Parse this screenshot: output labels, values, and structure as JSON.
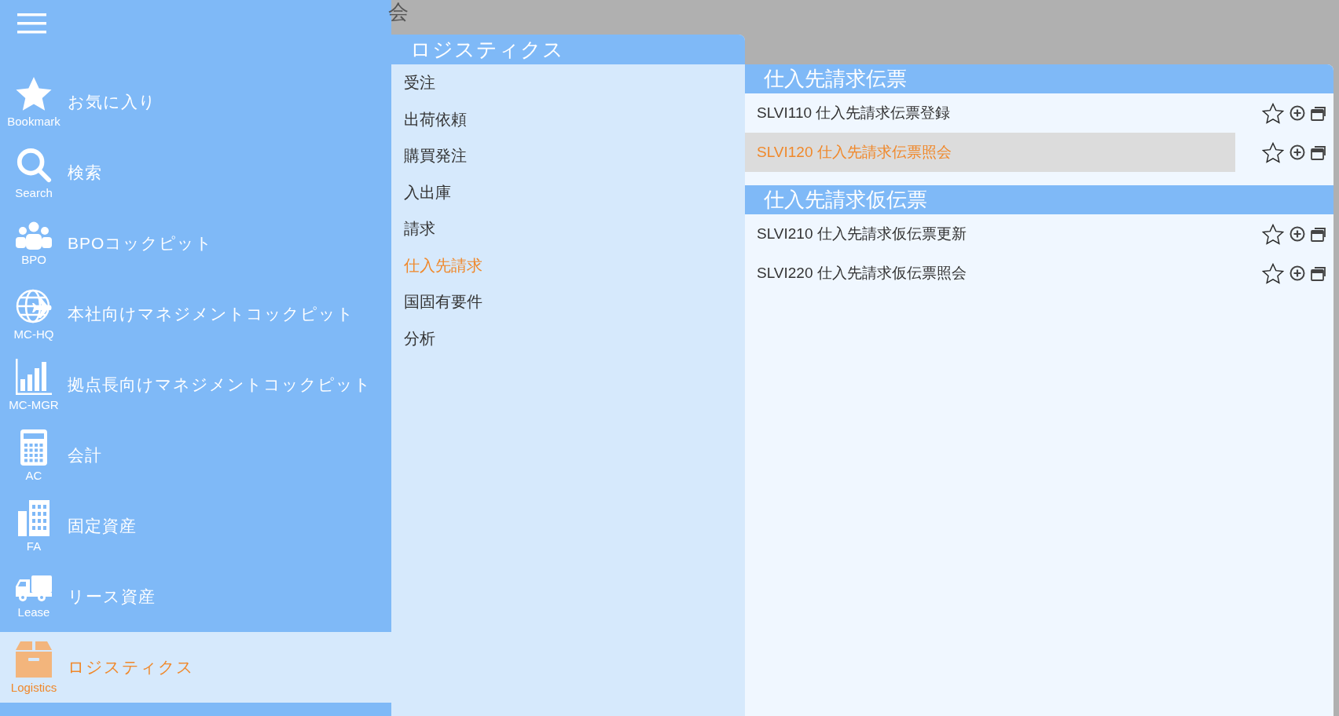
{
  "header": {
    "title": "会"
  },
  "sidebar": {
    "items": [
      {
        "label": "お気に入り",
        "caption": "Bookmark",
        "selected": false
      },
      {
        "label": "検索",
        "caption": "Search",
        "selected": false
      },
      {
        "label": "BPOコックピット",
        "caption": "BPO",
        "selected": false
      },
      {
        "label": "本社向けマネジメントコックピット",
        "caption": "MC-HQ",
        "selected": false
      },
      {
        "label": "拠点長向けマネジメントコックピット",
        "caption": "MC-MGR",
        "selected": false
      },
      {
        "label": "会計",
        "caption": "AC",
        "selected": false
      },
      {
        "label": "固定資産",
        "caption": "FA",
        "selected": false
      },
      {
        "label": "リース資産",
        "caption": "Lease",
        "selected": false
      },
      {
        "label": "ロジスティクス",
        "caption": "Logistics",
        "selected": true
      }
    ]
  },
  "category_panel": {
    "title": "ロジスティクス",
    "items": [
      {
        "label": "受注",
        "selected": false
      },
      {
        "label": "出荷依頼",
        "selected": false
      },
      {
        "label": "購買発注",
        "selected": false
      },
      {
        "label": "入出庫",
        "selected": false
      },
      {
        "label": "請求",
        "selected": false
      },
      {
        "label": "仕入先請求",
        "selected": true
      },
      {
        "label": "国固有要件",
        "selected": false
      },
      {
        "label": "分析",
        "selected": false
      }
    ]
  },
  "program_panel": {
    "groups": [
      {
        "title": "仕入先請求伝票",
        "programs": [
          {
            "label": "SLVI110 仕入先請求伝票登録",
            "selected": false
          },
          {
            "label": "SLVI120 仕入先請求伝票照会",
            "selected": true
          }
        ]
      },
      {
        "title": "仕入先請求仮伝票",
        "programs": [
          {
            "label": "SLVI210 仕入先請求仮伝票更新",
            "selected": false
          },
          {
            "label": "SLVI220 仕入先請求仮伝票照会",
            "selected": false
          }
        ]
      }
    ]
  }
}
